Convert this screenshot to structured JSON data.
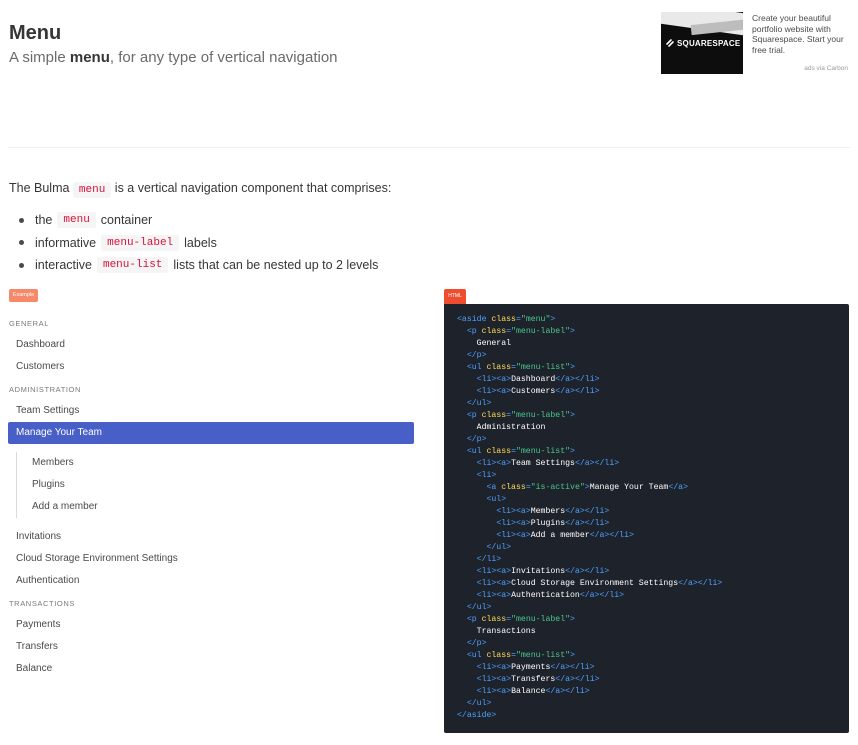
{
  "header": {
    "title": "Menu",
    "subtitle_prefix": "A simple ",
    "subtitle_strong": "menu",
    "subtitle_suffix": ", for any type of vertical navigation"
  },
  "ad": {
    "brand": "SQUARESPACE",
    "text": "Create your beautiful portfolio website with Squarespace. Start your free trial.",
    "via": "ads via Carbon"
  },
  "intro": {
    "before": "The Bulma ",
    "code": "menu",
    "after": " is a vertical navigation component that comprises:"
  },
  "bullets": [
    {
      "before": "the",
      "code": "menu",
      "after": "container"
    },
    {
      "before": "informative",
      "code": "menu-label",
      "after": "labels"
    },
    {
      "before": "interactive",
      "code": "menu-list",
      "after": "lists that can be nested up to 2 levels"
    }
  ],
  "badges": {
    "example": "Example",
    "html": "HTML"
  },
  "menu": {
    "general_label": "General",
    "general_items": [
      "Dashboard",
      "Customers"
    ],
    "admin_label": "Administration",
    "admin_items": [
      "Team Settings",
      "Manage Your Team"
    ],
    "team_subitems": [
      "Members",
      "Plugins",
      "Add a member"
    ],
    "admin_more_items": [
      "Invitations",
      "Cloud Storage Environment Settings",
      "Authentication"
    ],
    "transactions_label": "Transactions",
    "transactions_items": [
      "Payments",
      "Transfers",
      "Balance"
    ]
  },
  "code": {
    "aside_open": "aside",
    "class_attr": "class",
    "menu_class": "\"menu\"",
    "label_class": "\"menu-label\"",
    "list_class": "\"menu-list\"",
    "active_class": "\"is-active\"",
    "general": "General",
    "administration": "Administration",
    "transactions": "Transactions"
  },
  "colors": {
    "active_bg": "#485fc7",
    "code_bg": "#1e222b",
    "example_badge": "#f5896a",
    "html_badge": "#ee4e2f",
    "code_tag": "#4ea1ff",
    "code_attr": "#ffdd57",
    "code_string": "#48c78e",
    "inline_code": "#da1039"
  }
}
